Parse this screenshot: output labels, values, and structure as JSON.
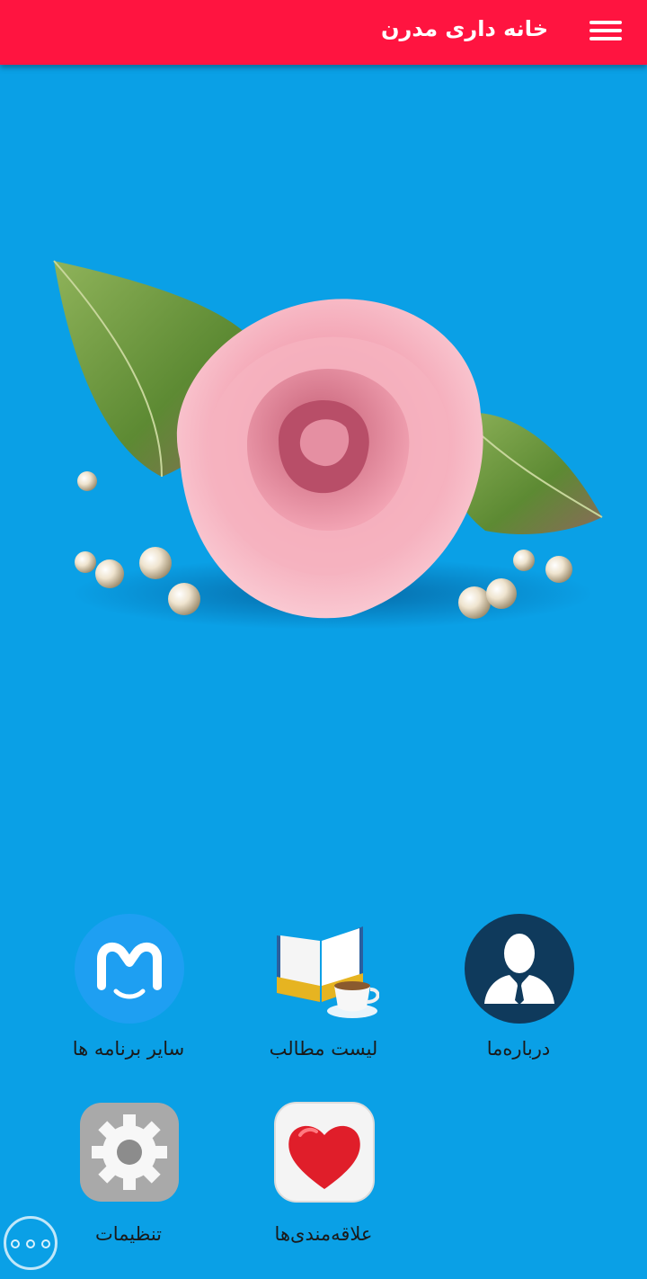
{
  "app_bar": {
    "title": "خانه داری مدرن",
    "menu_icon": "hamburger-menu-icon",
    "background": "#ff1440"
  },
  "main": {
    "background": "#0aa0e6",
    "hero_image": "pink-rose-with-pearls"
  },
  "grid": {
    "tiles": [
      {
        "label": "درباره‌ما",
        "icon": "person-avatar-icon"
      },
      {
        "label": "لیست مطالب",
        "icon": "book-and-coffee-icon"
      },
      {
        "label": "سایر برنامه ها",
        "icon": "myket-logo-icon"
      },
      {
        "label": "علاقه‌مندی‌ها",
        "icon": "heart-icon"
      },
      {
        "label": "تنظیمات",
        "icon": "gear-icon"
      }
    ]
  },
  "floating": {
    "more_icon": "more-dots-icon"
  }
}
